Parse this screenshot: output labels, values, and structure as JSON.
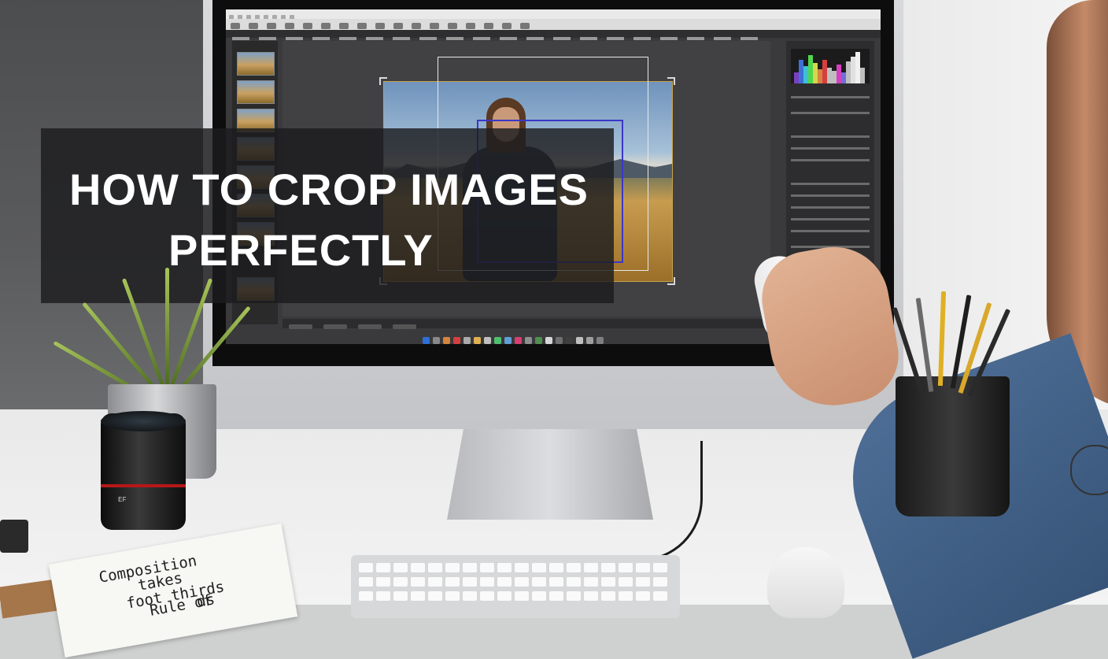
{
  "title": {
    "line1": "HOW TO CROP IMAGES",
    "line2": "PERFECTLY"
  },
  "notebook": {
    "line1": "Composition",
    "line2": "takes",
    "line3": "foot thirds",
    "line4": "Rule of",
    "line5": "ds"
  },
  "lens": {
    "label": "EF"
  },
  "colors": {
    "banner": "#1c1c1e",
    "title_text": "#ffffff",
    "crop_inner": "#3b36c9",
    "crop_outer": "#e8e8e8",
    "app_bg": "#3a3a3c"
  },
  "icons": {
    "histogram": "histogram-icon",
    "crop_handle": "crop-handle-icon"
  }
}
